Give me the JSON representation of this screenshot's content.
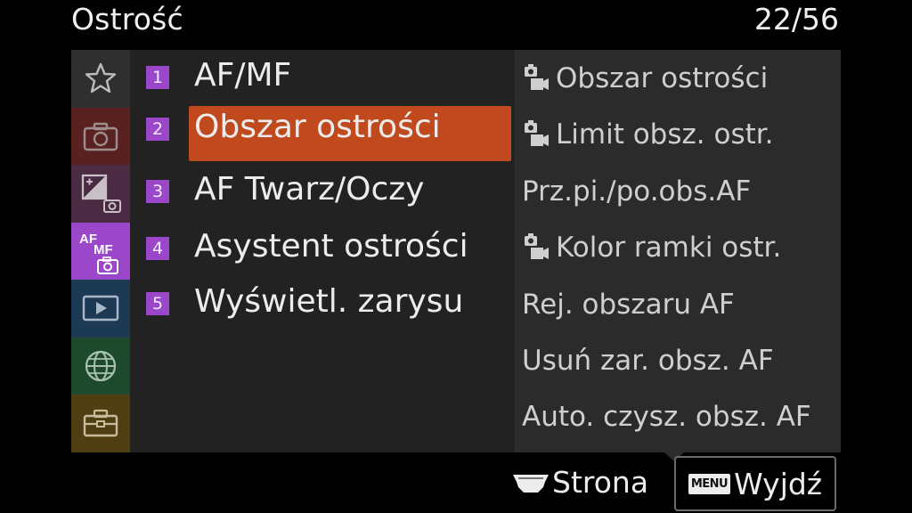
{
  "header": {
    "title": "Ostrość",
    "page": "22/56"
  },
  "sidebar": {
    "categories": [
      {
        "icon": "star-icon",
        "color": "#2f2f2f"
      },
      {
        "icon": "camera-icon",
        "color": "#5a2121"
      },
      {
        "icon": "exposure-camera-icon",
        "color": "#4b2b44"
      },
      {
        "icon": "af-mf-icon",
        "color": "#9a47c9",
        "label_top": "AF",
        "label_sub": "MF"
      },
      {
        "icon": "playback-icon",
        "color": "#1d3a55"
      },
      {
        "icon": "globe-icon",
        "color": "#1d4a2c"
      },
      {
        "icon": "toolbox-icon",
        "color": "#4f3e12"
      }
    ]
  },
  "menu": {
    "items": [
      {
        "num": "1",
        "label": "AF/MF"
      },
      {
        "num": "2",
        "label": "Obszar ostrości",
        "selected": true
      },
      {
        "num": "3",
        "label": "AF Twarz/Oczy"
      },
      {
        "num": "4",
        "label": "Asystent ostrości"
      },
      {
        "num": "5",
        "label": "Wyświetl. zarysu"
      }
    ],
    "highlight_color": "#c04a1d",
    "number_badge_color": "#9a47c9"
  },
  "submenu": {
    "items": [
      {
        "label": "Obszar ostrości",
        "icon": "still-movie-icon"
      },
      {
        "label": "Limit obsz. ostr.",
        "icon": "still-movie-icon"
      },
      {
        "label": "Prz.pi./po.obs.AF"
      },
      {
        "label": "Kolor ramki ostr.",
        "icon": "still-movie-icon"
      },
      {
        "label": "Rej. obszaru AF"
      },
      {
        "label": "Usuń zar. obsz. AF"
      },
      {
        "label": "Auto. czysz. obsz. AF"
      }
    ]
  },
  "footer": {
    "page_label": "Strona",
    "page_icon": "dial-wheel-icon",
    "exit_label": "Wyjdź",
    "exit_tag": "MENU"
  }
}
